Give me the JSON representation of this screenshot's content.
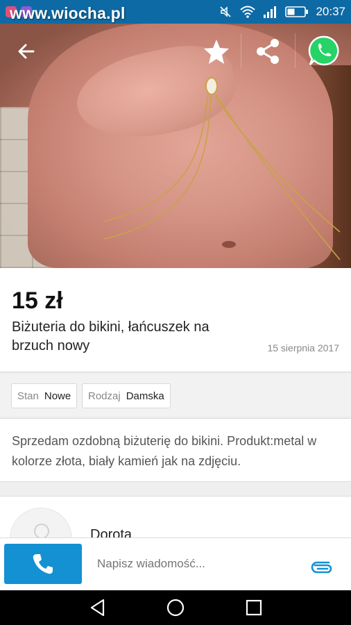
{
  "status_bar": {
    "watermark": "www.wiocha.pl",
    "time": "20:37",
    "icons": [
      "mute-icon",
      "wifi-icon",
      "signal-icon",
      "battery-icon"
    ]
  },
  "header": {
    "back_icon": "arrow-back-icon",
    "favorite_icon": "star-icon",
    "share_icon": "share-icon",
    "whatsapp_icon": "whatsapp-icon"
  },
  "listing": {
    "price": "15 zł",
    "title": "Biżuteria do bikini, łańcuszek na brzuch nowy",
    "date": "15 sierpnia 2017",
    "params": [
      {
        "key": "Stan",
        "value": "Nowe"
      },
      {
        "key": "Rodzaj",
        "value": "Damska"
      }
    ],
    "description": "Sprzedam ozdobną biżuterię do bikini. Produkt:metal w kolorze złota, biały kamień jak na zdjęciu."
  },
  "seller": {
    "name": "Dorota"
  },
  "message_bar": {
    "placeholder": "Napisz wiadomość..."
  },
  "colors": {
    "status_bar": "#0e6aa5",
    "call_button": "#1391d2",
    "whatsapp": "#25d366",
    "clip": "#1391d2"
  }
}
